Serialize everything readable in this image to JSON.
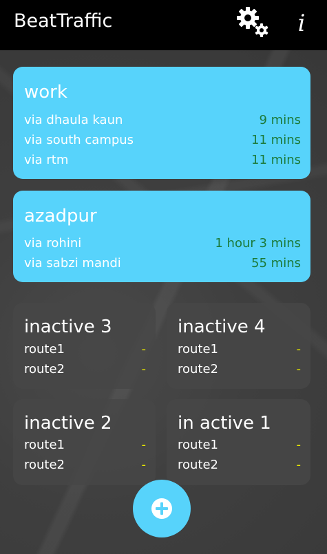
{
  "app": {
    "title": "BeatTraffic"
  },
  "actions": {
    "info_label": "i"
  },
  "active_cards": [
    {
      "title": "work",
      "routes": [
        {
          "name": "via dhaula kaun",
          "time": "9 mins"
        },
        {
          "name": "via south campus",
          "time": "11 mins"
        },
        {
          "name": "via rtm",
          "time": "11 mins"
        }
      ]
    },
    {
      "title": "azadpur",
      "routes": [
        {
          "name": "via rohini",
          "time": "1 hour 3 mins"
        },
        {
          "name": "via sabzi mandi",
          "time": "55 mins"
        }
      ]
    }
  ],
  "inactive_cards": [
    {
      "title": "inactive 3",
      "routes": [
        {
          "name": "route1",
          "time": "-"
        },
        {
          "name": "route2",
          "time": "-"
        }
      ]
    },
    {
      "title": "inactive 4",
      "routes": [
        {
          "name": "route1",
          "time": "-"
        },
        {
          "name": "route2",
          "time": "-"
        }
      ]
    },
    {
      "title": "inactive 2",
      "routes": [
        {
          "name": "route1",
          "time": "-"
        },
        {
          "name": "route2",
          "time": "-"
        }
      ]
    },
    {
      "title": "in active 1",
      "routes": [
        {
          "name": "route1",
          "time": "-"
        },
        {
          "name": "route2",
          "time": "-"
        }
      ]
    }
  ],
  "colors": {
    "active_card": "#57d3fb",
    "active_time": "#1c7a3a",
    "inactive_time": "#e6e600",
    "action_bar": "#000000"
  },
  "icons": {
    "settings": "gears-icon",
    "info": "info-icon",
    "add": "plus-circle-icon"
  }
}
